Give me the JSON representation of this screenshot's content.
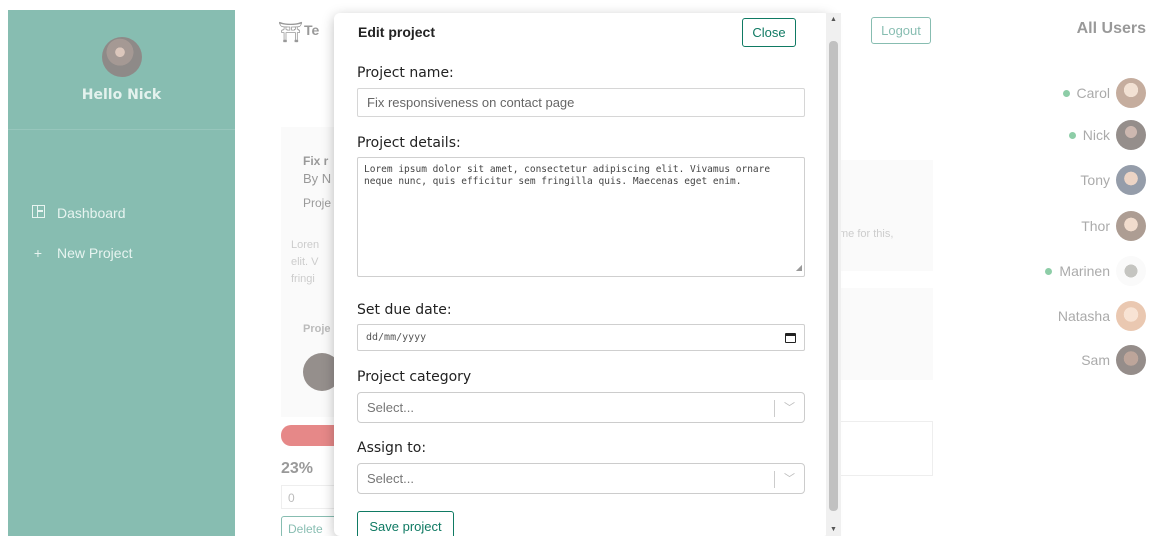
{
  "sidebar": {
    "greeting": "Hello Nick",
    "nav": [
      {
        "label": "Dashboard",
        "icon": "dashboard-icon"
      },
      {
        "label": "New Project",
        "icon": "plus-icon"
      }
    ],
    "color": "#0f7a63"
  },
  "background": {
    "logo_text": "Te",
    "logout_label": "Logout",
    "card": {
      "title": "Fix r",
      "by": "By N",
      "proj": "Proje",
      "body_1": "Loren",
      "body_2": "elit. V",
      "body_3": "fringi",
      "proj2": "Proje"
    },
    "progress_text": "23%",
    "progress_value": 0.23,
    "zero_value": "0",
    "delete_label": "Delete",
    "snippet": "me for this,"
  },
  "users": {
    "title": "All Users",
    "list": [
      {
        "name": "Carol",
        "online": true
      },
      {
        "name": "Nick",
        "online": true
      },
      {
        "name": "Tony",
        "online": false
      },
      {
        "name": "Thor",
        "online": false
      },
      {
        "name": "Marinen",
        "online": true
      },
      {
        "name": "Natasha",
        "online": false
      },
      {
        "name": "Sam",
        "online": false
      }
    ]
  },
  "modal": {
    "title": "Edit project",
    "close_label": "Close",
    "name_label": "Project name:",
    "name_value": "Fix responsiveness on contact page",
    "details_label": "Project details:",
    "details_value": "Lorem ipsum dolor sit amet, consectetur adipiscing elit. Vivamus ornare neque nunc, quis efficitur sem fringilla quis. Maecenas eget enim.",
    "due_label": "Set due date:",
    "due_placeholder": "dd/mm/yyyy",
    "category_label": "Project category",
    "category_placeholder": "Select...",
    "assign_label": "Assign to:",
    "assign_placeholder": "Select...",
    "save_label": "Save project"
  },
  "colors": {
    "accent": "#0f7a63",
    "online": "#1b9a4f",
    "progress": "#cc1010"
  }
}
